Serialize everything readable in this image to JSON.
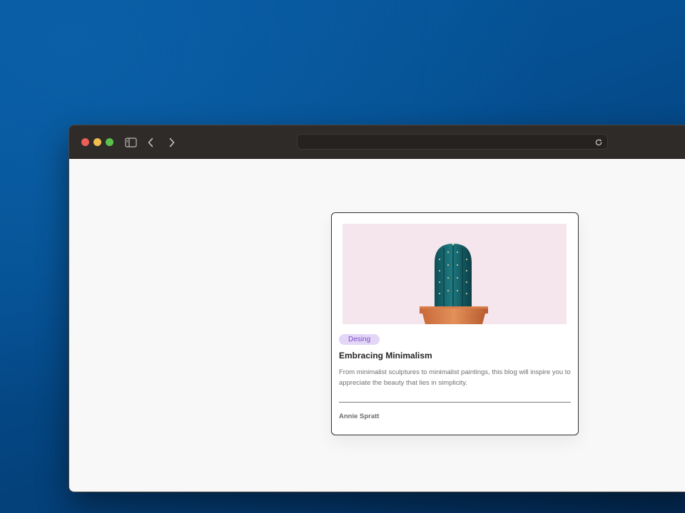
{
  "browser": {
    "window_controls": [
      "close",
      "minimize",
      "maximize"
    ],
    "toolbar_icons": [
      "sidebar-icon",
      "chevron-left-icon",
      "chevron-right-icon",
      "reload-icon"
    ],
    "url": ""
  },
  "card": {
    "image_subject": "cactus in a terracotta pot",
    "tag": "Desing",
    "title": "Embracing Minimalism",
    "description": "From minimalist sculptures to minimalist paintings, this blog will inspire you to appreciate the beauty that lies in simplicity.",
    "author": "Annie Spratt"
  },
  "colors": {
    "titlebar": "#2f2b29",
    "page_background": "#f8f8f8",
    "image_background": "#f5e6ed",
    "tag_background": "#e3d6f7",
    "tag_text": "#7b4fc9"
  }
}
